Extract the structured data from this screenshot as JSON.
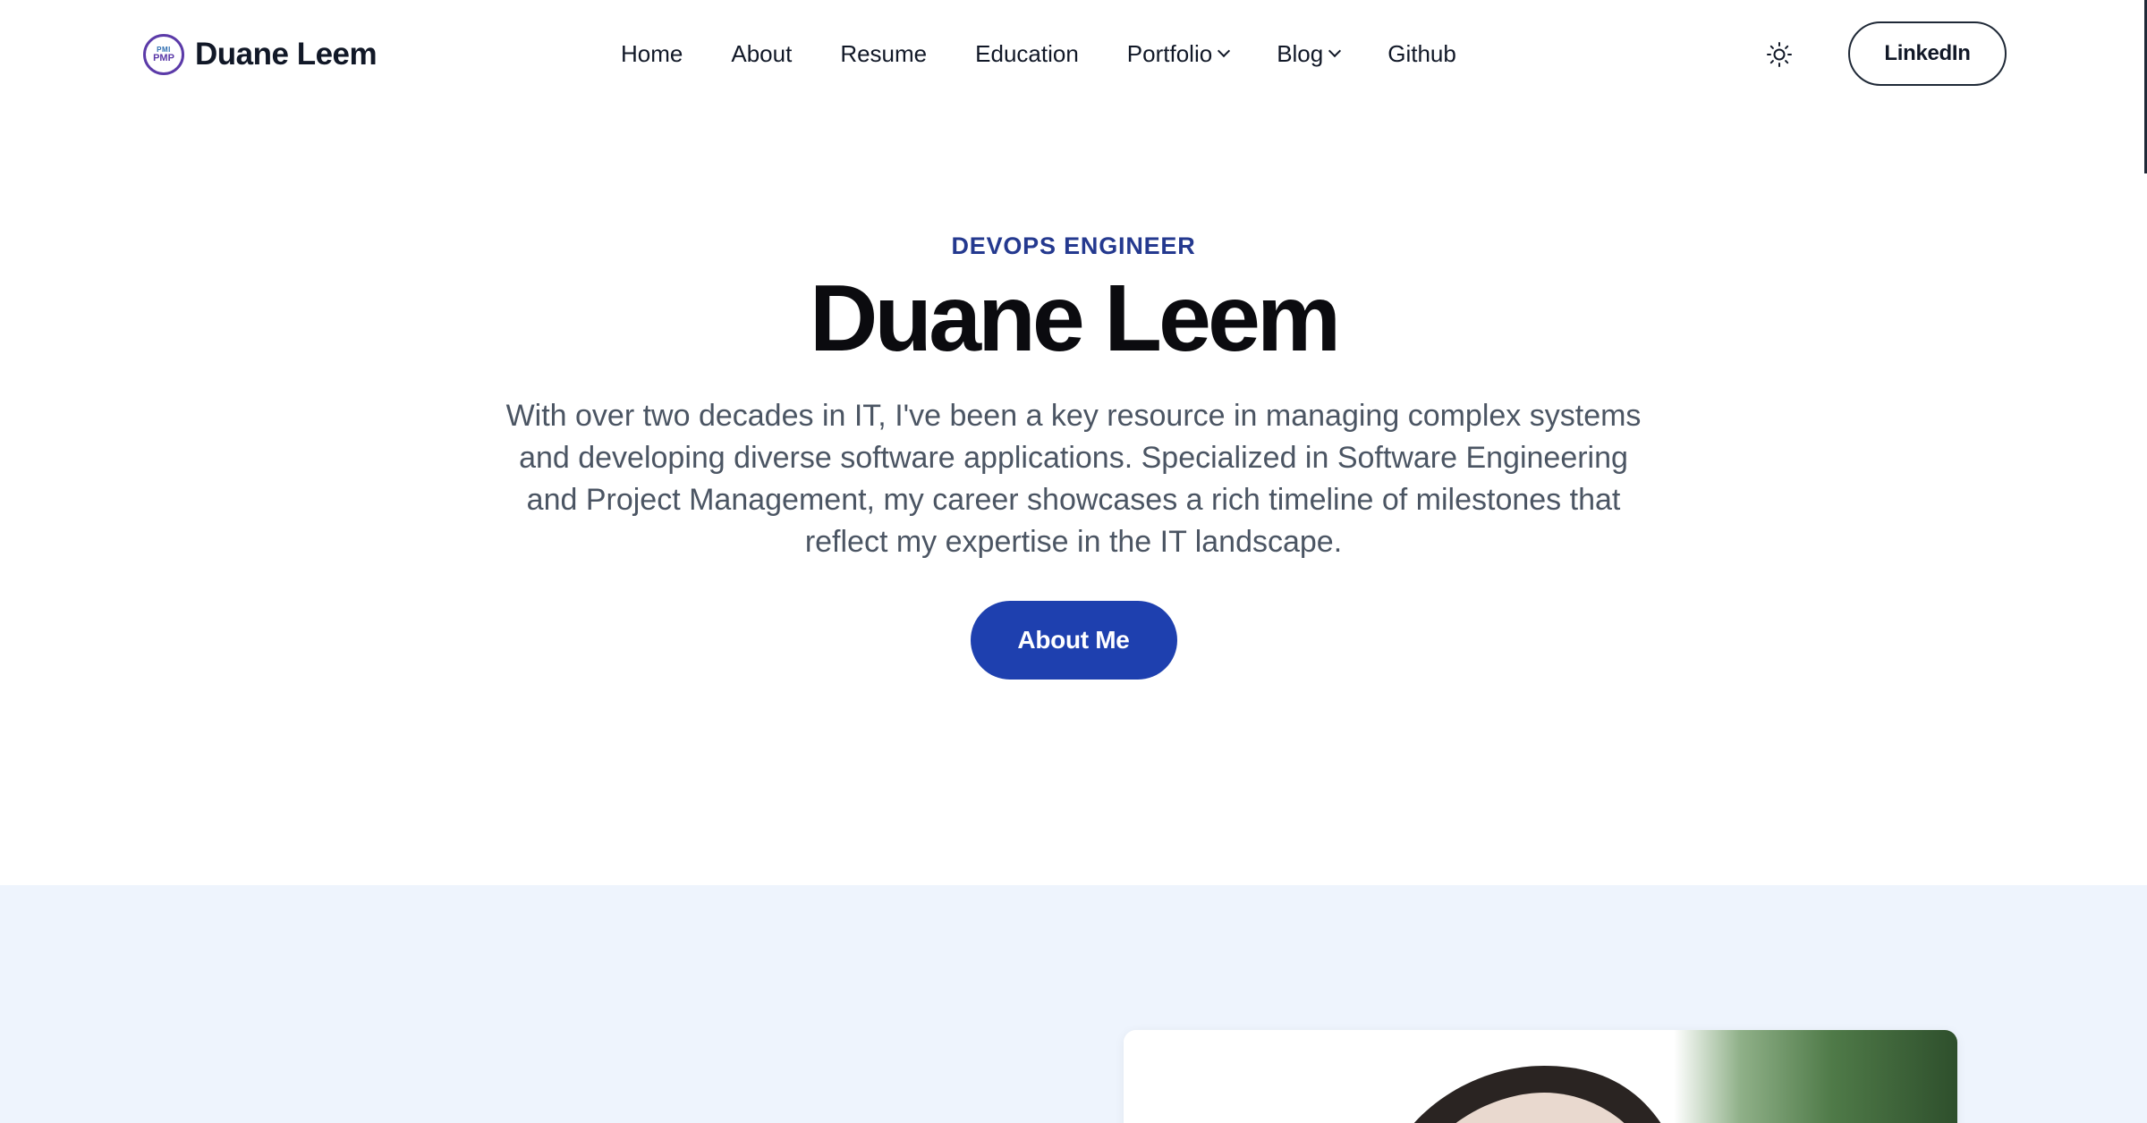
{
  "brand": {
    "name": "Duane Leem",
    "logo_text_top": "PMI",
    "logo_text_bottom": "PMP"
  },
  "nav": {
    "items": [
      {
        "label": "Home",
        "dropdown": false
      },
      {
        "label": "About",
        "dropdown": false
      },
      {
        "label": "Resume",
        "dropdown": false
      },
      {
        "label": "Education",
        "dropdown": false
      },
      {
        "label": "Portfolio",
        "dropdown": true
      },
      {
        "label": "Blog",
        "dropdown": true
      },
      {
        "label": "Github",
        "dropdown": false
      }
    ],
    "theme_toggle_icon": "sun-icon",
    "linkedin_label": "LinkedIn"
  },
  "hero": {
    "eyebrow": "DEVOPS ENGINEER",
    "title": "Duane Leem",
    "description": "With over two decades in IT, I've been a key resource in managing complex systems and developing diverse software applications. Specialized in Software Engineering and Project Management, my career showcases a rich timeline of milestones that reflect my expertise in the IT landscape.",
    "cta_label": "About Me"
  },
  "colors": {
    "accent": "#1e40af",
    "eyebrow": "#24398f",
    "section_bg": "#eef4fd"
  }
}
